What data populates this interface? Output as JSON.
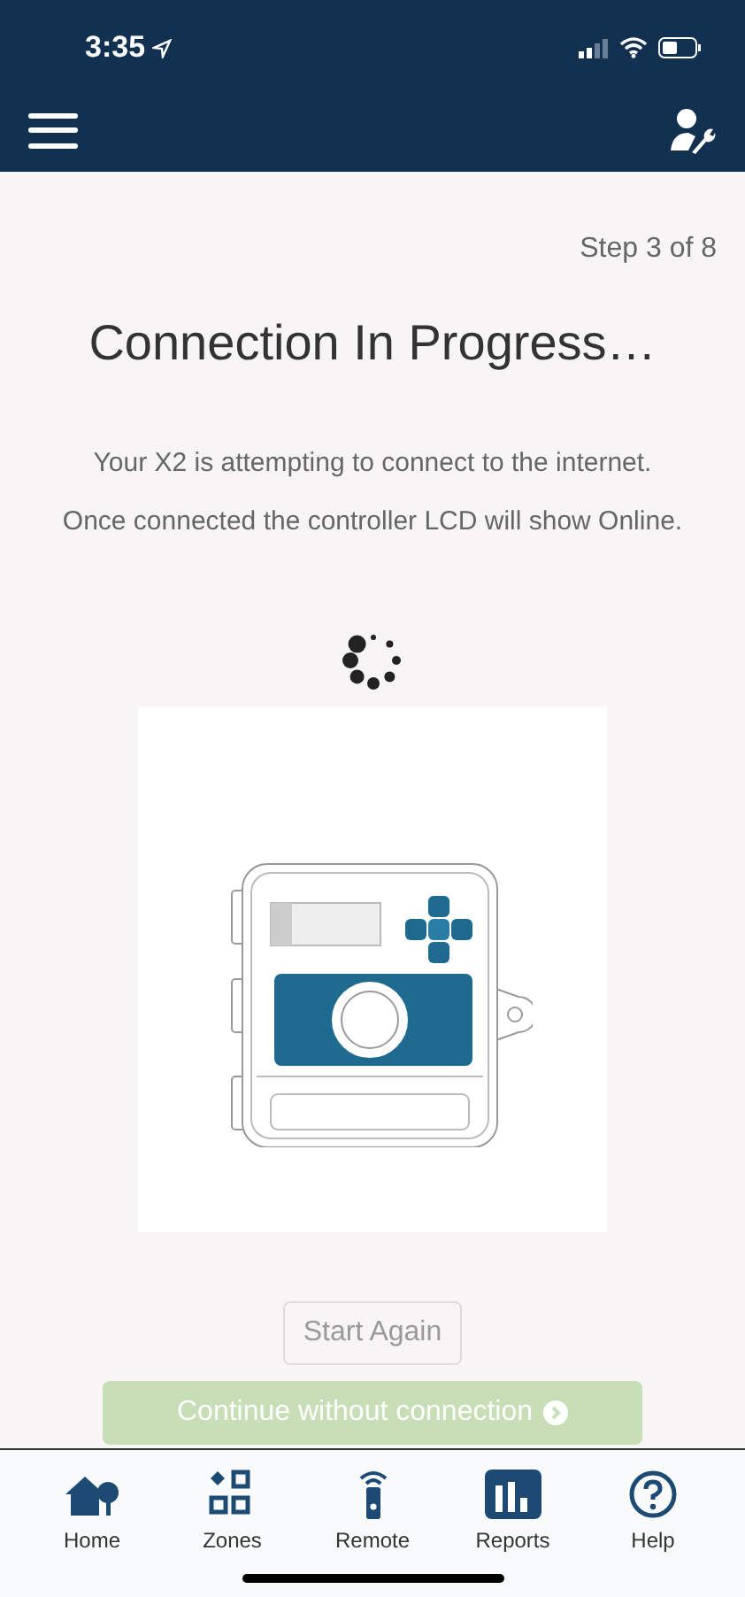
{
  "status_bar": {
    "time": "3:35"
  },
  "step": "Step 3 of 8",
  "title": "Connection In Progress…",
  "messages": [
    "Your X2 is attempting to connect to the internet.",
    "Once connected the controller LCD will show Online."
  ],
  "buttons": [
    {
      "kind": "outline",
      "label": "Start Again",
      "disabled": true
    },
    {
      "kind": "primary",
      "label": "Continue without connection",
      "disabled": true
    }
  ],
  "tab_bar": [
    {
      "kind": "home",
      "label": "Home"
    },
    {
      "kind": "zones",
      "label": "Zones"
    },
    {
      "kind": "remote",
      "label": "Remote"
    },
    {
      "kind": "reports",
      "label": "Reports"
    },
    {
      "kind": "help",
      "label": "Help"
    }
  ]
}
